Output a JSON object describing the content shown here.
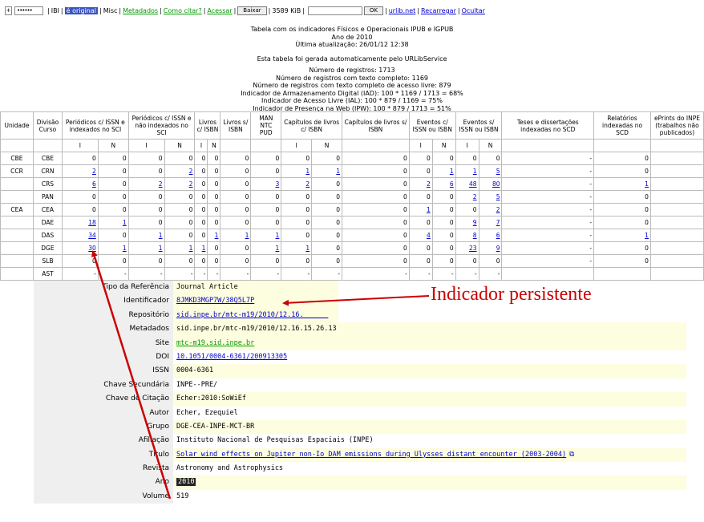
{
  "topbar": {
    "plus": "+",
    "password_mask": "••••••",
    "ibi": "IBI",
    "original": "é original",
    "misc": "Misc",
    "metadados": "Metadados",
    "como_citar": "Como citar?",
    "acessar": "Acessar",
    "baixar": "Baixar",
    "size": "3589 KiB",
    "ok": "OK",
    "urlib": "urlib.net",
    "recarregar": "Recarregar",
    "ocultar": "Ocultar"
  },
  "info": {
    "l1": "Tabela com os indicadores Físicos e Operacionais IPUB e IGPUB",
    "l2": "Ano de 2010",
    "l3": "Última atualização: 26/01/12 12:38",
    "l4": "Esta tabela foi gerada automaticamente pelo URLibService",
    "l5": "Número de registros: 1713",
    "l6": "Número de registros com texto completo: 1169",
    "l7": "Número de registros com texto completo de acesso livre: 879",
    "l8": "Indicador de Armazenamento Digital (IAD): 100 * 1169 / 1713 = 68%",
    "l9": "Indicador de Acesso Livre (IAL): 100 * 879 / 1169 = 75%",
    "l10": "Indicador de Presença na Web (IPW): 100 * 879 / 1713 = 51%"
  },
  "table": {
    "headers": [
      "Unidade",
      "Divisão Curso",
      "Periódicos c/ ISSN e indexados no SCI",
      "Periódicos c/ ISSN e não indexados no SCI",
      "Livros c/ ISBN",
      "Livros s/ ISBN",
      "MAN NTC PUD",
      "Capítulos de livros c/ ISBN",
      "Capítulos de livros s/ ISBN",
      "Eventos c/ ISSN ou ISBN",
      "Eventos s/ ISSN ou ISBN",
      "Teses e dissertações indexadas no SCD",
      "Relatórios indexadas no SCD",
      "ePrints do INPE (trabalhos não publicados)"
    ],
    "subheaders": [
      "",
      "",
      "I",
      "N",
      "I",
      "N",
      "I",
      "N",
      "",
      "",
      "I",
      "N",
      "",
      "I",
      "N",
      "I",
      "N",
      "",
      "",
      ""
    ],
    "rows": [
      [
        "CBE",
        "CBE",
        "0",
        "0",
        "0",
        "0",
        "0",
        "0",
        "0",
        "0",
        "0",
        "0",
        "0",
        "0",
        "0",
        "0",
        "0",
        "-",
        "0",
        ""
      ],
      [
        "CCR",
        "CRN",
        "2",
        "0",
        "0",
        "2",
        "0",
        "0",
        "0",
        "0",
        "1",
        "1",
        "0",
        "0",
        "1",
        "1",
        "5",
        "-",
        "0",
        ""
      ],
      [
        "",
        "CRS",
        "6",
        "0",
        "2",
        "2",
        "0",
        "0",
        "0",
        "3",
        "2",
        "0",
        "0",
        "2",
        "6",
        "48",
        "80",
        "-",
        "1",
        ""
      ],
      [
        "",
        "PAN",
        "0",
        "0",
        "0",
        "0",
        "0",
        "0",
        "0",
        "0",
        "0",
        "0",
        "0",
        "0",
        "0",
        "2",
        "5",
        "-",
        "0",
        ""
      ],
      [
        "CEA",
        "CEA",
        "0",
        "0",
        "0",
        "0",
        "0",
        "0",
        "0",
        "0",
        "0",
        "0",
        "0",
        "1",
        "0",
        "0",
        "2",
        "-",
        "0",
        ""
      ],
      [
        "",
        "DAE",
        "18",
        "1",
        "0",
        "0",
        "0",
        "0",
        "0",
        "0",
        "0",
        "0",
        "0",
        "0",
        "0",
        "9",
        "7",
        "-",
        "0",
        ""
      ],
      [
        "",
        "DAS",
        "34",
        "0",
        "1",
        "0",
        "0",
        "1",
        "1",
        "1",
        "0",
        "0",
        "0",
        "4",
        "0",
        "8",
        "6",
        "-",
        "1",
        ""
      ],
      [
        "",
        "DGE",
        "30",
        "1",
        "1",
        "1",
        "1",
        "0",
        "0",
        "1",
        "1",
        "0",
        "0",
        "0",
        "0",
        "23",
        "9",
        "-",
        "0",
        ""
      ],
      [
        "",
        "SLB",
        "0",
        "0",
        "0",
        "0",
        "0",
        "0",
        "0",
        "0",
        "0",
        "0",
        "0",
        "0",
        "0",
        "0",
        "0",
        "-",
        "0",
        ""
      ],
      [
        "",
        "AST",
        "-",
        "-",
        "-",
        "-",
        "-",
        "-",
        "-",
        "-",
        "-",
        "-",
        "-",
        "-",
        "-",
        "-",
        "-",
        "",
        "",
        ""
      ]
    ]
  },
  "panel": {
    "rows": [
      {
        "label": "Tipo da Referência",
        "value": "Journal Article"
      },
      {
        "label": "Identificador",
        "value": "8JMKD3MGP7W/38Q5L7P"
      },
      {
        "label": "Repositório",
        "value": "sid.inpe.br/mtc-m19/2010/12.16.______"
      },
      {
        "label": "Metadados",
        "value": "sid.inpe.br/mtc-m19/2010/12.16.15.26.13"
      },
      {
        "label": "Site",
        "value": "mtc-m19.sid.inpe.br"
      },
      {
        "label": "DOI",
        "value": "10.1051/0004-6361/200913305"
      },
      {
        "label": "ISSN",
        "value": "0004-6361"
      },
      {
        "label": "Chave Secundária",
        "value": "INPE--PRE/"
      },
      {
        "label": "Chave de Citação",
        "value": "Echer:2010:SoWiEf"
      },
      {
        "label": "Autor",
        "value": "Echer, Ezequiel"
      },
      {
        "label": "Grupo",
        "value": "DGE-CEA-INPE-MCT-BR"
      },
      {
        "label": "Afiliação",
        "value": "Instituto Nacional de Pesquisas Espaciais (INPE)"
      },
      {
        "label": "Título",
        "value": "Solar wind effects on Jupiter non-Io DAM emissions during Ulysses distant encounter (2003-2004)"
      },
      {
        "label": "Revista",
        "value": "Astronomy and Astrophysics"
      },
      {
        "label": "Ano",
        "value": "2010"
      },
      {
        "label": "Volume",
        "value": "519"
      }
    ]
  },
  "annotation": "Indicador persistente",
  "colors": {
    "annotation": "#cc0000",
    "link": "#0000cc",
    "site_link": "#009900",
    "highlight": "#3a54c0"
  }
}
